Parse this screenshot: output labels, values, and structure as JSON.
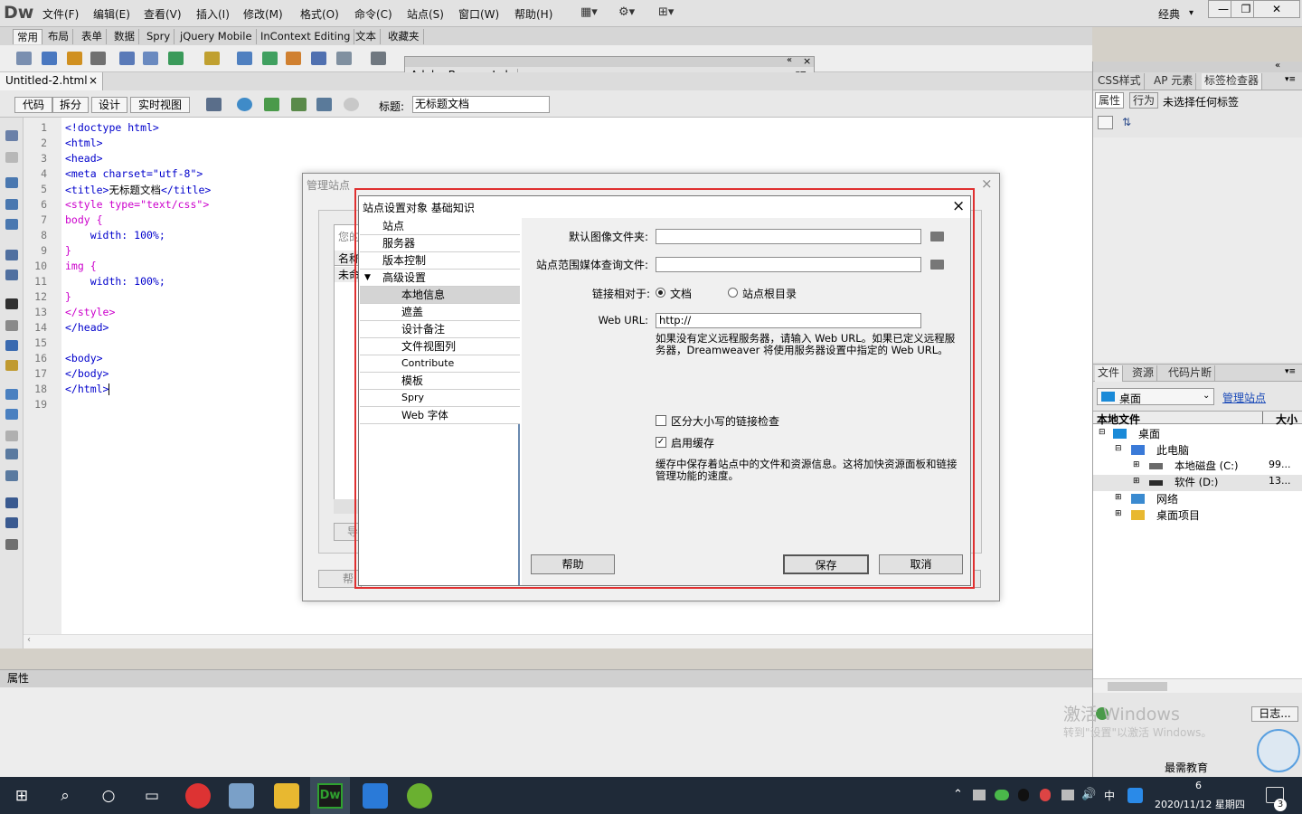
{
  "app": {
    "logo": "Dw"
  },
  "menu": [
    "文件(F)",
    "编辑(E)",
    "查看(V)",
    "插入(I)",
    "修改(M)",
    "格式(O)",
    "命令(C)",
    "站点(S)",
    "窗口(W)",
    "帮助(H)"
  ],
  "workspace": {
    "label": "经典",
    "dropdown": "▾"
  },
  "window_controls": {
    "minimize": "—",
    "restore": "❐",
    "close": "✕"
  },
  "insert_tabs": [
    "常用",
    "布局",
    "表单",
    "数据",
    "Spry",
    "jQuery Mobile",
    "InContext Editing",
    "文本",
    "收藏夹"
  ],
  "document_tab": {
    "name": "Untitled-2.html",
    "close": "×"
  },
  "view_buttons": [
    "代码",
    "拆分",
    "设计",
    "实时视图"
  ],
  "title_field": {
    "label": "标题:",
    "value": "无标题文档"
  },
  "code": {
    "line_numbers": [
      "1",
      "2",
      "3",
      "4",
      "5",
      "6",
      "7",
      "8",
      "9",
      "10",
      "11",
      "12",
      "13",
      "14",
      "15",
      "16",
      "17",
      "18",
      "19"
    ],
    "lines": [
      [
        {
          "t": "<!doctype html>",
          "c": "#0000cc"
        }
      ],
      [
        {
          "t": "<html>",
          "c": "#0000cc"
        }
      ],
      [
        {
          "t": "<head>",
          "c": "#0000cc"
        }
      ],
      [
        {
          "t": "<meta charset=\"utf-8\">",
          "c": "#0000cc"
        }
      ],
      [
        {
          "t": "<title>",
          "c": "#0000cc"
        },
        {
          "t": "无标题文档",
          "c": "#000000"
        },
        {
          "t": "</title>",
          "c": "#0000cc"
        }
      ],
      [
        {
          "t": "<style type=\"text/css\">",
          "c": "#cc00cc"
        }
      ],
      [
        {
          "t": "body {",
          "c": "#cc00cc"
        }
      ],
      [
        {
          "t": "    width: 100%;",
          "c": "#0000cc"
        }
      ],
      [
        {
          "t": "}",
          "c": "#cc00cc"
        }
      ],
      [
        {
          "t": "img {",
          "c": "#cc00cc"
        }
      ],
      [
        {
          "t": "    width: 100%;",
          "c": "#0000cc"
        }
      ],
      [
        {
          "t": "}",
          "c": "#cc00cc"
        }
      ],
      [
        {
          "t": "</style>",
          "c": "#cc00cc"
        }
      ],
      [
        {
          "t": "</head>",
          "c": "#0000cc"
        }
      ],
      [],
      [
        {
          "t": "<body>",
          "c": "#0000cc"
        }
      ],
      [
        {
          "t": "</body>",
          "c": "#0000cc"
        }
      ],
      [
        {
          "t": "</html>",
          "c": "#0000cc"
        }
      ],
      []
    ]
  },
  "properties_panel": {
    "title": "属性"
  },
  "browserlab": {
    "title": "Adobe BrowserLab",
    "collapse": "«",
    "close": "×",
    "menu": "▾≡"
  },
  "css_panel": {
    "tabs": [
      "CSS样式",
      "AP 元素",
      "标签检查器"
    ],
    "subtabs": [
      "属性",
      "行为"
    ],
    "status": "未选择任何标签"
  },
  "files_panel": {
    "tabs": [
      "文件",
      "资源",
      "代码片断"
    ],
    "site_select": "桌面",
    "manage_link": "管理站点",
    "columns": [
      "本地文件",
      "大小"
    ],
    "tree": [
      {
        "label": "桌面",
        "size": ""
      },
      {
        "label": "此电脑",
        "size": ""
      },
      {
        "label": "本地磁盘 (C:)",
        "size": "99..."
      },
      {
        "label": "软件 (D:)",
        "size": "13..."
      },
      {
        "label": "网络",
        "size": ""
      },
      {
        "label": "桌面项目",
        "size": ""
      }
    ],
    "log_button": "日志..."
  },
  "manage_sites": {
    "title": "管理站点",
    "close": "×",
    "peek_text": [
      "您的",
      "名称",
      "未命",
      "导",
      "帮"
    ]
  },
  "site_dialog": {
    "title": "站点设置对象 基础知识",
    "close": "×",
    "categories": [
      {
        "label": "站点",
        "indent": 1
      },
      {
        "label": "服务器",
        "indent": 1
      },
      {
        "label": "版本控制",
        "indent": 1
      },
      {
        "label": "高级设置",
        "indent": 1,
        "expanded": true
      },
      {
        "label": "本地信息",
        "indent": 2,
        "selected": true
      },
      {
        "label": "遮盖",
        "indent": 2
      },
      {
        "label": "设计备注",
        "indent": 2
      },
      {
        "label": "文件视图列",
        "indent": 2
      },
      {
        "label": "Contribute",
        "indent": 2
      },
      {
        "label": "模板",
        "indent": 2
      },
      {
        "label": "Spry",
        "indent": 2
      },
      {
        "label": "Web 字体",
        "indent": 2
      }
    ],
    "fields": {
      "default_image_folder": {
        "label": "默认图像文件夹:",
        "value": ""
      },
      "media_query_file": {
        "label": "站点范围媒体查询文件:",
        "value": ""
      },
      "links_relative_to": {
        "label": "链接相对于:",
        "options": [
          "文档",
          "站点根目录"
        ],
        "selected": "文档"
      },
      "web_url": {
        "label": "Web URL:",
        "value": "http://"
      },
      "web_url_note": "如果没有定义远程服务器，请输入 Web URL。如果已定义远程服务器，Dreamweaver 将使用服务器设置中指定的 Web URL。",
      "case_sensitive": {
        "label": "区分大小写的链接检查",
        "checked": false
      },
      "enable_cache": {
        "label": "启用缓存",
        "checked": true
      },
      "cache_note": "缓存中保存着站点中的文件和资源信息。这将加快资源面板和链接管理功能的速度。"
    },
    "buttons": {
      "help": "帮助",
      "save": "保存",
      "cancel": "取消"
    }
  },
  "watermark": {
    "line1": "激活 Windows",
    "line2": "转到\"设置\"以激活 Windows。",
    "brand": "最需教育"
  },
  "taskbar": {
    "ime": "中",
    "time": "6",
    "date": "2020/11/12 星期四",
    "notifications": "3"
  },
  "colors": {
    "accent_red": "#e03030",
    "taskbar": "#1f2a38",
    "dw_green": "#2fa12f"
  }
}
